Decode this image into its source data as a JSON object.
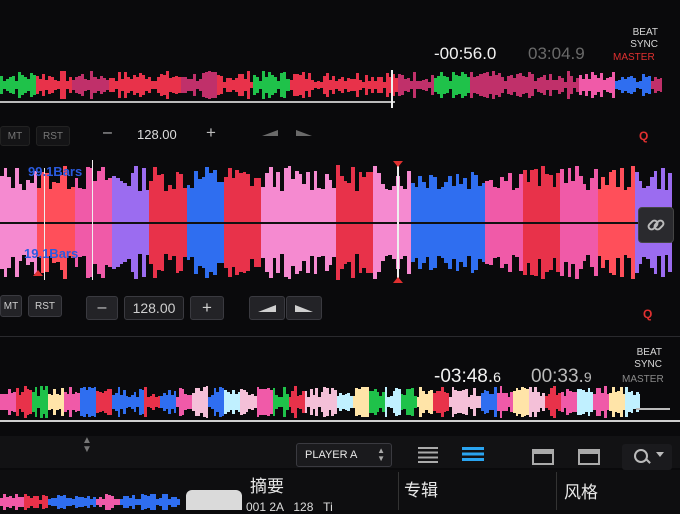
{
  "deck_top": {
    "elapsed": "-00:56.0",
    "remaining": "03:04.9",
    "beat": "BEAT",
    "sync": "SYNC",
    "master": "MASTER",
    "mt": "MT",
    "rst": "RST",
    "minus": "–",
    "bpm": "128.00",
    "plus": "+",
    "q": "Q"
  },
  "big_waveform": {
    "label_top": "99.1Bars",
    "label_bottom": "19.1Bars"
  },
  "deck_bottom": {
    "mt": "MT",
    "rst": "RST",
    "minus": "–",
    "bpm": "128.00",
    "plus": "+",
    "q": "Q",
    "elapsed_main": "-03:48.",
    "elapsed_frac": "6",
    "remaining_main": "00:33.",
    "remaining_frac": "9",
    "beat": "BEAT",
    "sync": "SYNC",
    "master": "MASTER"
  },
  "browser": {
    "player_select": "PLAYER A",
    "columns": [
      "摘要",
      "专辑",
      "风格"
    ],
    "row_partial": "001 2A   128   Ti"
  },
  "colors": {
    "accent_red": "#e03030",
    "wave_pink": "#f05aa8",
    "wave_blue": "#2f6ef0",
    "list_blue": "#2aa4f0"
  }
}
